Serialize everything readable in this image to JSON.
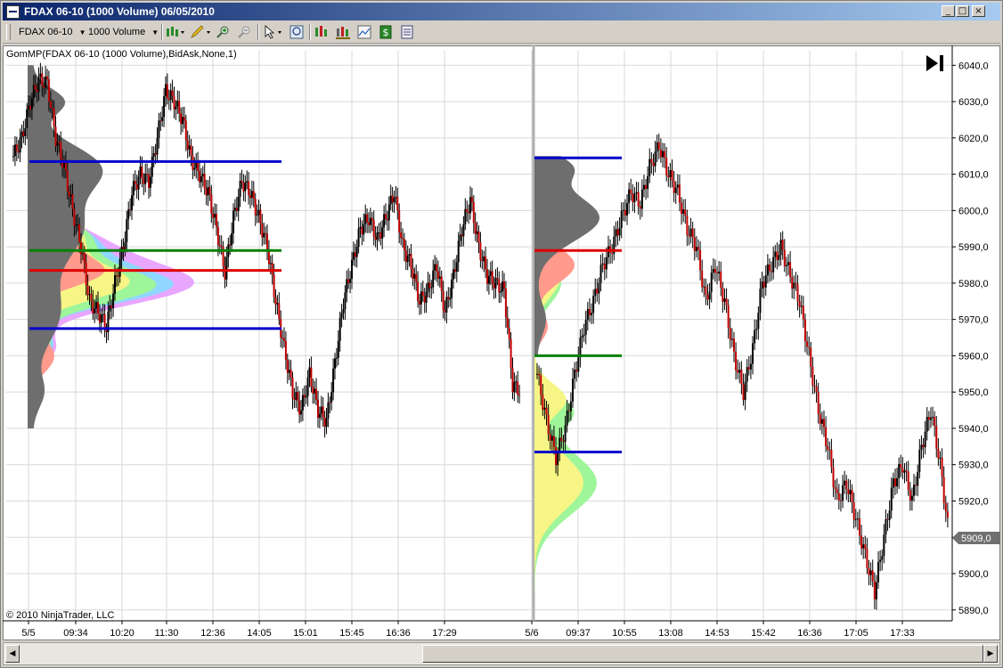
{
  "window": {
    "title": "FDAX 06-10 (1000 Volume)  06/05/2010",
    "minimize": "_",
    "maximize": "□",
    "close": "×"
  },
  "toolbar": {
    "instrument": "FDAX 06-10",
    "period": "1000 Volume",
    "icons": [
      "bar-type-icon",
      "drawing-pencil-icon",
      "zoom-in-icon",
      "zoom-out-icon",
      "cursor-icon",
      "magnifier-icon",
      "indicators-icon",
      "strategies-icon",
      "chart-properties-icon",
      "dollar-icon",
      "data-box-icon"
    ]
  },
  "chart": {
    "indicator_label": "GomMP(FDAX 06-10 (1000 Volume),BidAsk,None,1)",
    "copyright": "© 2010 NinjaTrader, LLC",
    "last_price": "5909,0",
    "colors": {
      "up_candle": "#000000",
      "down_candle": "#c00000",
      "profile_gray": "#6e6e6e",
      "value_area_line": "#0000cc",
      "poc_line": "#dd0000",
      "vwap_line": "#008000",
      "price_tag": "#707070"
    }
  },
  "chart_data": {
    "type": "line",
    "title": "",
    "ylabel": "",
    "xlabel": "",
    "ylim": [
      5887,
      6044
    ],
    "yticks": [
      "6040,0",
      "6030,0",
      "6020,0",
      "6010,0",
      "6000,0",
      "5990,0",
      "5980,0",
      "5970,0",
      "5960,0",
      "5950,0",
      "5940,0",
      "5930,0",
      "5920,0",
      "5910,0",
      "5900,0",
      "5890,0"
    ],
    "xticks": [
      "5/5",
      "09:34",
      "10:20",
      "11:30",
      "12:36",
      "14:05",
      "15:01",
      "15:45",
      "16:36",
      "17:29",
      "5/6",
      "09:37",
      "10:55",
      "13:08",
      "14:53",
      "15:42",
      "16:36",
      "17:05",
      "17:33"
    ],
    "series": [
      {
        "values": [
          6015,
          6020,
          6030,
          6036,
          6035,
          6020,
          6012,
          6000,
          5990,
          5975,
          5972,
          5968,
          5980,
          5990,
          6005,
          6010,
          6008,
          6020,
          6033,
          6030,
          6025,
          6014,
          6010,
          6005,
          5995,
          5983,
          5998,
          6008,
          6005,
          5998,
          5990,
          5975,
          5962,
          5950,
          5945,
          5955,
          5945,
          5942,
          5958,
          5975,
          5985,
          5995,
          5998,
          5992,
          5998,
          6005,
          5990,
          5985,
          5975,
          5978,
          5985,
          5972,
          5982,
          5995,
          6003,
          5990,
          5982,
          5980,
          5978,
          5952,
          5950
        ]
      },
      {
        "values": [
          5955,
          5942,
          5932,
          5940,
          5955,
          5968,
          5975,
          5985,
          5990,
          5998,
          6005,
          6002,
          6012,
          6018,
          6010,
          6005,
          5995,
          5990,
          5975,
          5985,
          5975,
          5960,
          5950,
          5962,
          5980,
          5985,
          5990,
          5982,
          5975,
          5960,
          5945,
          5935,
          5920,
          5925,
          5915,
          5905,
          5895,
          5910,
          5925,
          5930,
          5920,
          5935,
          5945,
          5930,
          5909
        ]
      }
    ],
    "sessions": [
      {
        "value_area_high": 6013.5,
        "value_area_low": 5967.5,
        "poc": 5983.5,
        "vwap": 5989
      },
      {
        "value_area_high": 6014.5,
        "value_area_low": 5933.5,
        "poc": 5989,
        "vwap": 5960
      }
    ]
  }
}
